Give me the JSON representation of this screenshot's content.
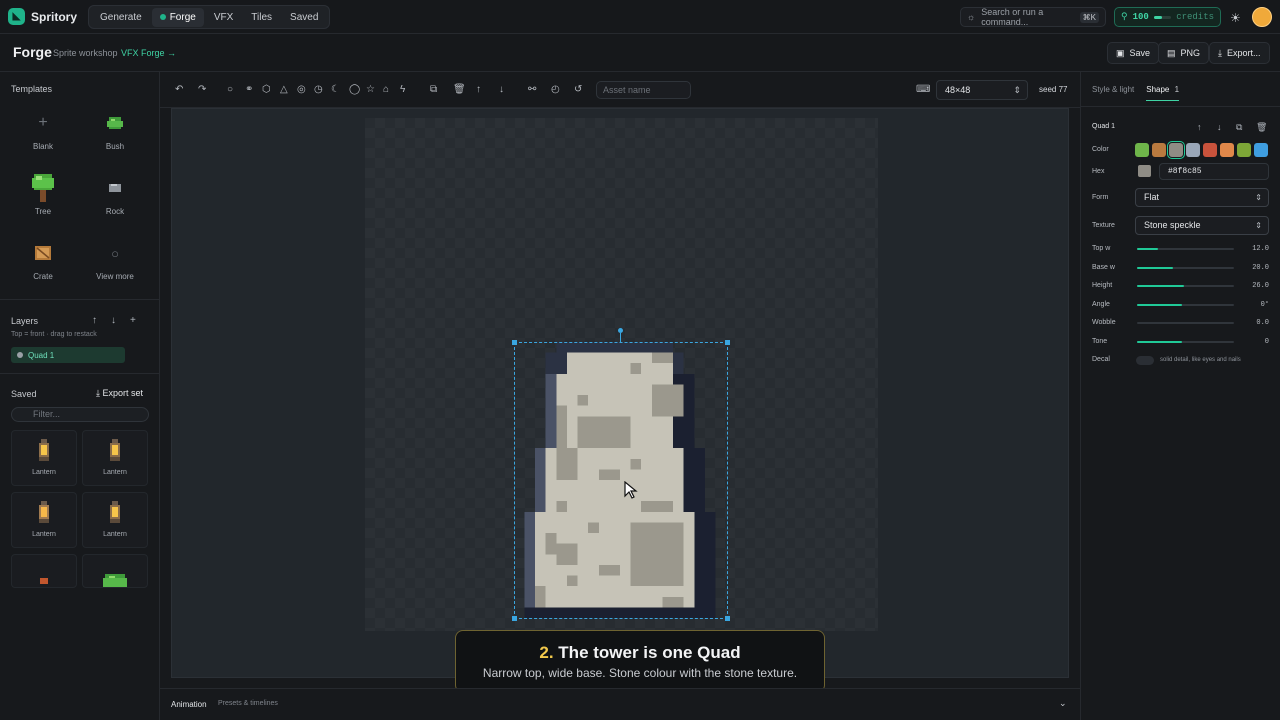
{
  "app": {
    "name": "Spritory"
  },
  "nav": {
    "tabs": [
      "Generate",
      "Forge",
      "VFX",
      "Tiles",
      "Saved"
    ],
    "active": "Forge"
  },
  "search": {
    "placeholder": "Search or run a command...",
    "shortcut": "⌘K"
  },
  "credits": {
    "amount": "100",
    "label": "credits",
    "fill": 0.48
  },
  "page": {
    "title": "Forge",
    "subtitle": "Sprite workshop",
    "link": "VFX Forge →"
  },
  "header_buttons": {
    "save": "Save",
    "png": "PNG",
    "export": "Export..."
  },
  "templates": {
    "title": "Templates",
    "items": [
      {
        "label": "Blank",
        "icon": "plus-icon"
      },
      {
        "label": "Bush",
        "icon": "bush-icon"
      },
      {
        "label": "Tree",
        "icon": "tree-icon"
      },
      {
        "label": "Rock",
        "icon": "rock-icon"
      },
      {
        "label": "Crate",
        "icon": "crate-icon"
      },
      {
        "label": "View more",
        "icon": "search-icon"
      }
    ]
  },
  "layers": {
    "title": "Layers",
    "hint": "Top = front · drag to restack",
    "items": [
      "Quad 1"
    ]
  },
  "saved": {
    "title": "Saved",
    "export_label": "Export set",
    "filter_placeholder": "Filter...",
    "items": [
      "Lantern",
      "Lantern",
      "Lantern",
      "Lantern",
      "",
      ""
    ]
  },
  "toolbar": {
    "asset_placeholder": "Asset name",
    "size": "48×48",
    "seed": "seed 77"
  },
  "caption": {
    "step": "2.",
    "title": "The tower is one Quad",
    "text": "Narrow top, wide base. Stone colour with the stone texture."
  },
  "animation": {
    "title": "Animation",
    "subtitle": "Presets & timelines"
  },
  "right": {
    "tabs": [
      "Style & light",
      "Shape"
    ],
    "shape_count": "1",
    "shape_name": "Quad 1",
    "color_label": "Color",
    "swatches": [
      "#6fb54a",
      "#b97a3f",
      "#8f8c85",
      "#9aa7b8",
      "#c9533c",
      "#e0884a",
      "#7da637",
      "#3f9ee0"
    ],
    "hex_label": "Hex",
    "hex": "#8f8c85",
    "form_label": "Form",
    "form": "Flat",
    "texture_label": "Texture",
    "texture": "Stone speckle",
    "sliders": [
      {
        "label": "Top w",
        "value": "12.0",
        "fill": 0.22
      },
      {
        "label": "Base w",
        "value": "20.0",
        "fill": 0.37
      },
      {
        "label": "Height",
        "value": "26.0",
        "fill": 0.48
      },
      {
        "label": "Angle",
        "value": "0°",
        "fill": 0.46
      },
      {
        "label": "Wobble",
        "value": "0.0",
        "fill": 0.0
      },
      {
        "label": "Tone",
        "value": "0",
        "fill": 0.46
      }
    ],
    "decal_label": "Decal",
    "decal_text": "solid detail, like eyes and nails"
  }
}
